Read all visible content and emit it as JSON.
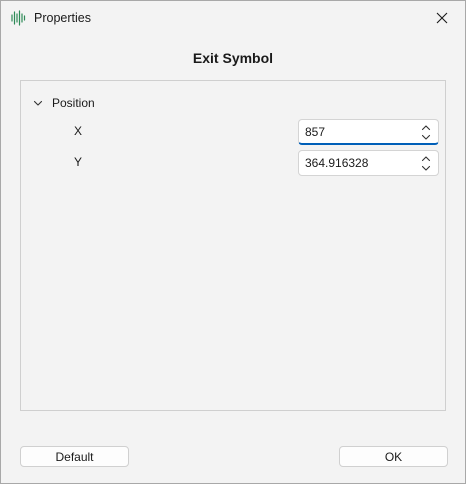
{
  "window": {
    "title": "Properties",
    "icon": "waveform-icon",
    "close_icon": "close-icon"
  },
  "heading": "Exit Symbol",
  "group": {
    "label": "Position",
    "expanded": true,
    "icon": "chevron-down-icon"
  },
  "properties": [
    {
      "label": "X",
      "value": "857"
    },
    {
      "label": "Y",
      "value": "364.916328"
    }
  ],
  "buttons": {
    "default_label": "Default",
    "ok_label": "OK"
  },
  "colors": {
    "accent": "#005fb8",
    "icon_green": "#2e8b57"
  }
}
